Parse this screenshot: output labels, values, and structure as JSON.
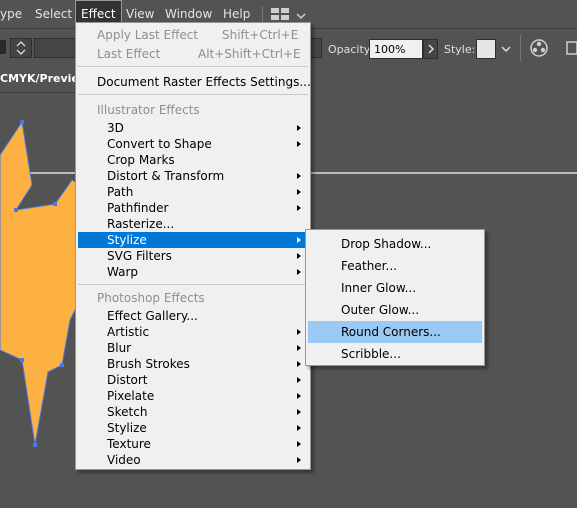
{
  "menubar": {
    "items": [
      "ype",
      "Select",
      "Effect",
      "View",
      "Window",
      "Help"
    ]
  },
  "controlbar": {
    "opacity_label": "Opacity:",
    "opacity_value": "100%",
    "style_label": "Style:"
  },
  "document_tab": {
    "title": "CMYK/Preview"
  },
  "effect_menu": {
    "apply_last": {
      "label": "Apply Last Effect",
      "shortcut": "Shift+Ctrl+E"
    },
    "last": {
      "label": "Last Effect",
      "shortcut": "Alt+Shift+Ctrl+E"
    },
    "raster_settings": "Document Raster Effects Settings...",
    "illustrator_header": "Illustrator Effects",
    "illustrator_items": [
      "3D",
      "Convert to Shape",
      "Crop Marks",
      "Distort & Transform",
      "Path",
      "Pathfinder",
      "Rasterize...",
      "Stylize",
      "SVG Filters",
      "Warp"
    ],
    "photoshop_header": "Photoshop Effects",
    "photoshop_items": [
      "Effect Gallery...",
      "Artistic",
      "Blur",
      "Brush Strokes",
      "Distort",
      "Pixelate",
      "Sketch",
      "Stylize",
      "Texture",
      "Video"
    ]
  },
  "stylize_submenu": {
    "items": [
      "Drop Shadow...",
      "Feather...",
      "Inner Glow...",
      "Outer Glow...",
      "Round Corners...",
      "Scribble..."
    ]
  },
  "colors": {
    "shape_fill": "#fdb143",
    "path_stroke": "#4a78e0",
    "highlight": "#0078d7",
    "hover": "#99c9f4"
  }
}
